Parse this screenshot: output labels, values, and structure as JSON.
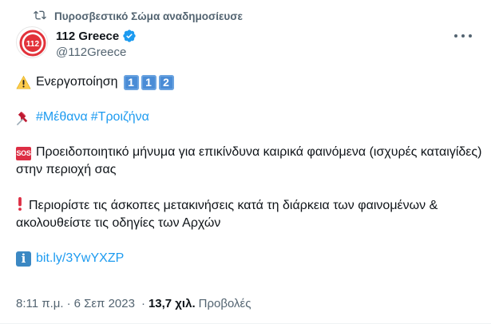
{
  "retweet": {
    "label": "Πυροσβεστικό Σώμα αναδημοσίευσε",
    "icon": "retweet-icon"
  },
  "author": {
    "name": "112 Greece",
    "handle": "@112Greece",
    "avatar_text": "112",
    "verified": true
  },
  "tweet": {
    "line1_text": "Ενεργοποίηση",
    "keycaps": [
      "1",
      "1",
      "2"
    ],
    "hashtags": [
      "#Μέθανα",
      "#Τροιζήνα"
    ],
    "sos_label": "SOS",
    "warning_text": "Προειδοποιητικό μήνυμα για επικίνδυνα καιρικά φαινόμενα (ισχυρές καταιγίδες) στην περιοχή σας",
    "advice_text": "Περιορίστε τις άσκοπες μετακινήσεις κατά τη διάρκεια των φαινομένων & ακολουθείστε τις οδηγίες των Αρχών",
    "link_text": "bit.ly/3YwYXZP",
    "info_label": "i"
  },
  "meta": {
    "time": "8:11 π.μ.",
    "separator": "·",
    "date": "6 Σεπ 2023",
    "views_count": "13,7 χιλ.",
    "views_label": "Προβολές"
  },
  "colors": {
    "accent": "#1d9bf0",
    "muted": "#536471",
    "keycap": "#4a8cd6",
    "sos": "#dd2e44",
    "info": "#3b88c3"
  }
}
